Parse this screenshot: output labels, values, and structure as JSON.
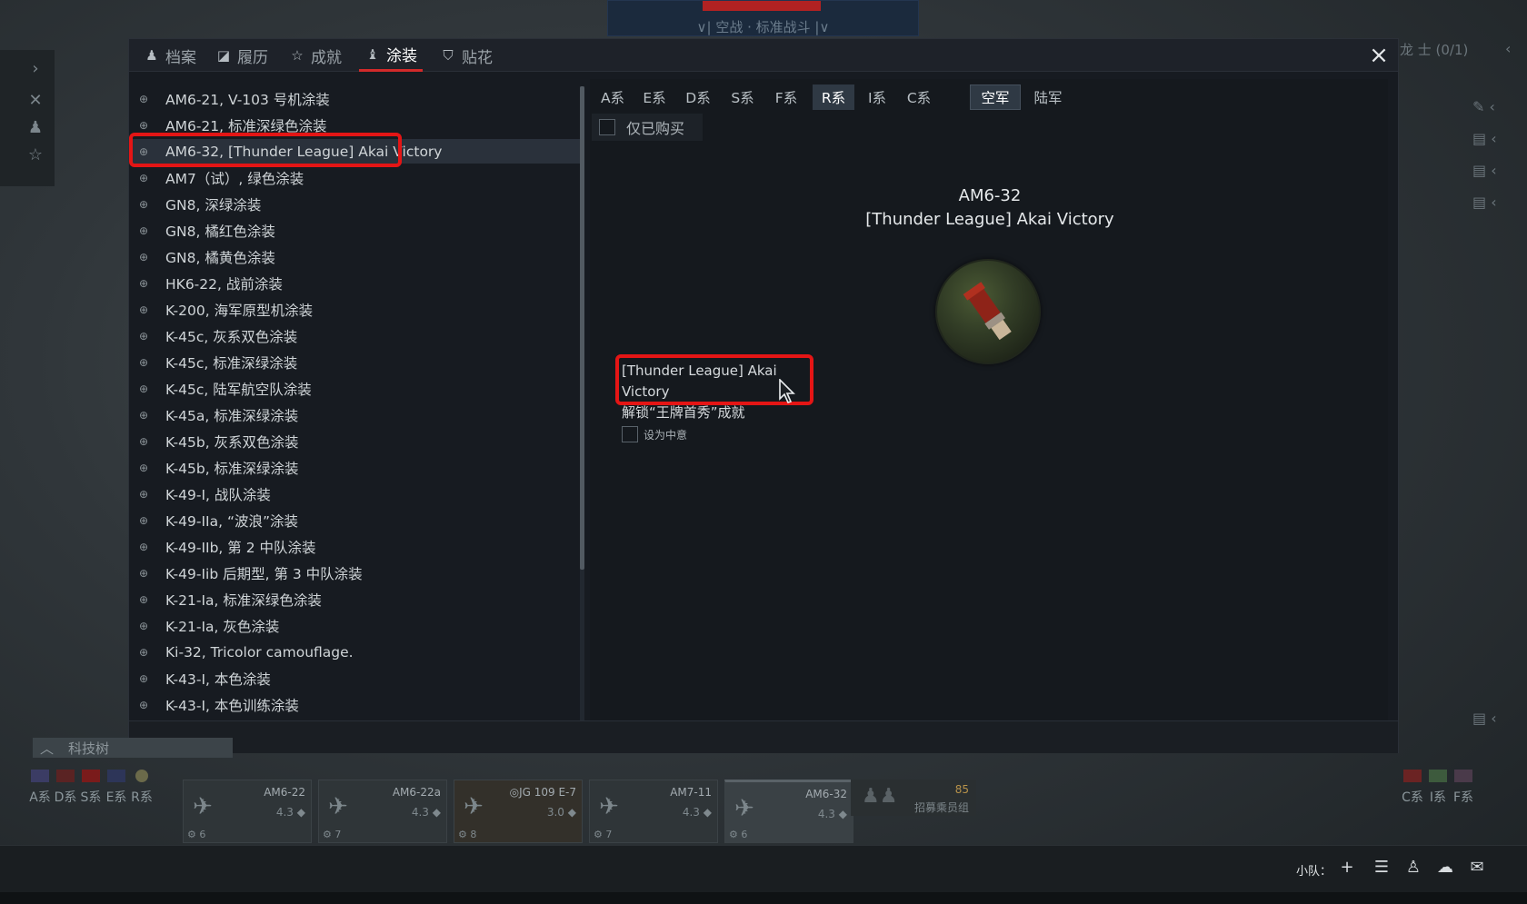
{
  "top_banner": {
    "mode_text": "∨| 空战 · 标准战斗 |∨"
  },
  "tabs": [
    {
      "label": "档案",
      "icon": "person-icon"
    },
    {
      "label": "履历",
      "icon": "journal-icon"
    },
    {
      "label": "成就",
      "icon": "star-icon"
    },
    {
      "label": "涂装",
      "icon": "paint-icon",
      "active": true
    },
    {
      "label": "贴花",
      "icon": "decal-icon"
    }
  ],
  "skins": [
    "AM6-21, V-103 号机涂装",
    "AM6-21, 标准深绿色涂装",
    "AM6-32, [Thunder League] Akai Victory",
    "AM7（试）, 绿色涂装",
    "GN8, 深绿涂装",
    "GN8, 橘红色涂装",
    "GN8, 橘黄色涂装",
    "HK6-22, 战前涂装",
    "K-200, 海军原型机涂装",
    "K-45c, 灰系双色涂装",
    "K-45c, 标准深绿涂装",
    "K-45c, 陆军航空队涂装",
    "K-45a, 标准深绿涂装",
    "K-45b, 灰系双色涂装",
    "K-45b, 标准深绿涂装",
    "K-49-I, 战队涂装",
    "K-49-IIa, “波浪”涂装",
    "K-49-IIb, 第 2 中队涂装",
    "K-49-Iib 后期型, 第 3 中队涂装",
    "K-21-Ia, 标准深绿色涂装",
    "K-21-Ia, 灰色涂装",
    "Ki-32, Tricolor camouflage.",
    "K-43-I, 本色涂装",
    "K-43-I, 本色训练涂装"
  ],
  "selected_skin_index": 2,
  "branch_filters": [
    "A系",
    "E系",
    "D系",
    "S系",
    "F系",
    "R系",
    "I系",
    "C系"
  ],
  "active_branch": "R系",
  "type_filters": [
    "空军",
    "陆军"
  ],
  "active_type": "空军",
  "only_bought_label": "仅已购买",
  "detail": {
    "title_line1": "AM6-32",
    "title_line2": "[Thunder League] Akai Victory",
    "unlock_name": "[Thunder League] Akai Victory",
    "unlock_condition": "解锁“王牌首秀”成就",
    "favorite_label": "设为中意"
  },
  "right_bar": {
    "title": "龙 士 (0/1)"
  },
  "tech_label": "科技树",
  "nations_left": [
    "A系",
    "D系",
    "S系",
    "E系",
    "R系"
  ],
  "nations_right": [
    "C系",
    "I系",
    "F系"
  ],
  "slots": [
    {
      "name": "AM6-22",
      "br": "4.3 ◆",
      "crew": "6"
    },
    {
      "name": "AM6-22a",
      "br": "4.3 ◆",
      "crew": "7"
    },
    {
      "name": "◎JG 109 E-7",
      "br": "3.0 ◆",
      "crew": "8"
    },
    {
      "name": "AM7-11",
      "br": "4.3 ◆",
      "crew": "7"
    },
    {
      "name": "AM6-32",
      "br": "4.3 ◆",
      "crew": "6"
    }
  ],
  "recruit": {
    "cost": "85",
    "label": "招募乘员组"
  },
  "footer": {
    "squad_label": "小队："
  },
  "colors": {
    "accent_red": "#d22a2a",
    "highlight_red": "#e41515"
  }
}
